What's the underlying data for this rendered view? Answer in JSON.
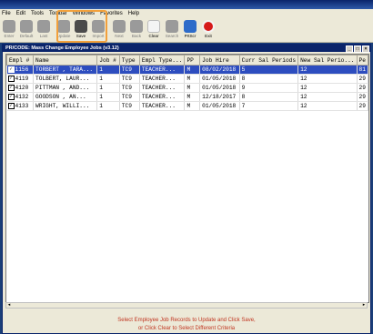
{
  "menu": [
    "File",
    "Edit",
    "Tools",
    "Toolbar",
    "Windows",
    "Favorites",
    "Help"
  ],
  "toolbar": [
    {
      "label": "Enter",
      "state": "disabled"
    },
    {
      "label": "Default",
      "state": "disabled"
    },
    {
      "label": "Last",
      "state": "disabled"
    },
    {
      "label": "Update",
      "state": "disabled"
    },
    {
      "label": "Save",
      "state": "active"
    },
    {
      "label": "Import",
      "state": "disabled"
    },
    {
      "label": "Next",
      "state": "disabled"
    },
    {
      "label": "Back",
      "state": "disabled"
    },
    {
      "label": "Clear",
      "state": "active"
    },
    {
      "label": "Search",
      "state": "disabled"
    },
    {
      "label": "PrtScr",
      "state": "active"
    },
    {
      "label": "Exit",
      "state": "active"
    }
  ],
  "window": {
    "title": "PR/CODE: Mass Change Employee Jobs (v3.12)"
  },
  "table": {
    "columns": [
      "Empl #",
      "Name",
      "Job #",
      "Type",
      "Empl Type...",
      "PP",
      "Job Hire",
      "Curr Sal Periods",
      "New Sal Perio...",
      "Pe"
    ],
    "rows": [
      {
        "checked": true,
        "selected": true,
        "cells": [
          "1156",
          "TORBERT , TARA...",
          "1",
          "TC9",
          "TEACHER...",
          "M",
          "08/02/2018",
          "5",
          "12",
          "81"
        ]
      },
      {
        "checked": true,
        "selected": false,
        "cells": [
          "4119",
          "TOLBERT, LAUR...",
          "1",
          "TC9",
          "TEACHER...",
          "M",
          "01/05/2018",
          "8",
          "12",
          "29"
        ]
      },
      {
        "checked": true,
        "selected": false,
        "cells": [
          "4120",
          "PITTMAN , AND...",
          "1",
          "TC9",
          "TEACHER...",
          "M",
          "01/05/2018",
          "9",
          "12",
          "29"
        ]
      },
      {
        "checked": true,
        "selected": false,
        "cells": [
          "4132",
          "GOODSON , AN...",
          "1",
          "TC9",
          "TEACHER...",
          "M",
          "12/18/2017",
          "8",
          "12",
          "29"
        ]
      },
      {
        "checked": true,
        "selected": false,
        "cells": [
          "4133",
          "WRIGHT, WILLI...",
          "1",
          "TC9",
          "TEACHER...",
          "M",
          "01/05/2018",
          "7",
          "12",
          "29"
        ]
      }
    ]
  },
  "message": {
    "line1": "Select Employee Job Records to Update and Click Save,",
    "line2": "or Click Clear to Select Different Criteria"
  }
}
